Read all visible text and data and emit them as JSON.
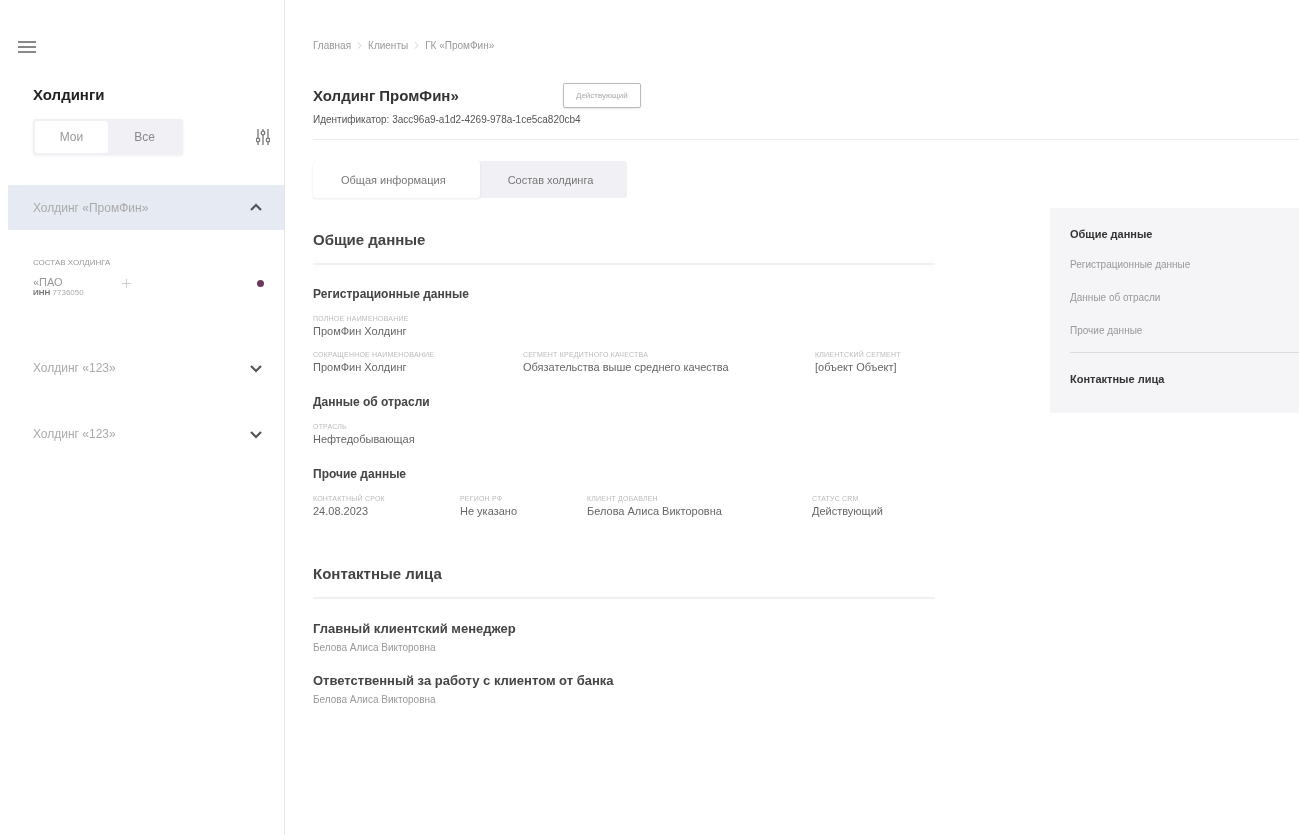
{
  "sidebar": {
    "title": "Холдинги",
    "filter_tabs": [
      {
        "label": "Мои",
        "selected": true
      },
      {
        "label": "Все",
        "selected": false
      }
    ],
    "holdings": [
      {
        "name": "Холдинг «ПромФин»",
        "expanded": true,
        "section_label": "СОСТАВ ХОЛДИНГА",
        "children": [
          {
            "name": "«ПАО",
            "inn_label": "ИНН",
            "inn": "7736050",
            "color": "#6b3a5a"
          }
        ]
      },
      {
        "name": "Холдинг «123»",
        "expanded": false
      },
      {
        "name": "Холдинг «123»",
        "expanded": false
      }
    ]
  },
  "breadcrumbs": [
    "Главная",
    "Клиенты",
    "ГК «ПромФин»"
  ],
  "header": {
    "title": "Холдинг ПромФин»",
    "status": "Действующий",
    "identifier": "Идентификатор: 3acc96a9-a1d2-4269-978a-1ce5ca820cb4"
  },
  "tabs": [
    {
      "label": "Общая информация",
      "selected": true
    },
    {
      "label": "Состав холдинга",
      "selected": false
    }
  ],
  "general": {
    "title": "Общие данные",
    "subsections": [
      {
        "title": "Регистрационные данные",
        "rows": [
          [
            {
              "label": "ПОЛНОЕ НАИМЕНОВАНИЕ",
              "value": "ПромФин Холдинг"
            }
          ],
          [
            {
              "label": "СОКРАЩЕННОЕ НАИМЕНОВАНИЕ",
              "value": "ПромФин Холдинг"
            },
            {
              "label": "СЕГМЕНТ КРЕДИТНОГО КАЧЕСТВА",
              "value": "Обязательства выше среднего качества"
            },
            {
              "label": "КЛИЕНТСКИЙ СЕГМЕНТ",
              "value": "[объект Объект]"
            }
          ]
        ]
      },
      {
        "title": "Данные об отрасли",
        "rows": [
          [
            {
              "label": "ОТРАСЛЬ",
              "value": "Нефтедобывающая"
            }
          ]
        ]
      },
      {
        "title": "Прочие данные",
        "rows": [
          [
            {
              "label": "КОНТАКТНЫЙ СРОК",
              "value": "24.08.2023"
            },
            {
              "label": "РЕГИОН РФ",
              "value": "Не указано"
            },
            {
              "label": "КЛИЕНТ ДОБАВЛЕН",
              "value": "Белова Алиса Викторовна"
            },
            {
              "label": "СТАТУС CRM",
              "value": "Действующий"
            }
          ]
        ]
      }
    ]
  },
  "contacts": {
    "title": "Контактные лица",
    "items": [
      {
        "role": "Главный клиентский менеджер",
        "name": "Белова Алиса Викторовна"
      },
      {
        "role": "Ответственный за работу с клиентом от банка",
        "name": "Белова Алиса Викторовна"
      }
    ]
  },
  "page_nav": [
    {
      "label": "Общие данные",
      "kind": "heading"
    },
    {
      "label": "Регистрационные данные",
      "kind": "link"
    },
    {
      "label": "Данные об отрасли",
      "kind": "link"
    },
    {
      "label": "Прочие данные",
      "kind": "link"
    },
    {
      "label": "Контактные лица",
      "kind": "heading"
    }
  ]
}
